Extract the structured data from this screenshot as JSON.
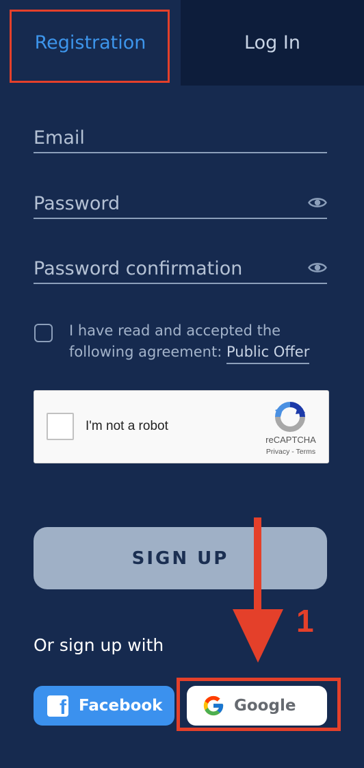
{
  "tabs": {
    "registration": "Registration",
    "login": "Log In"
  },
  "form": {
    "email_placeholder": "Email",
    "password_placeholder": "Password",
    "password_confirmation_placeholder": "Password confirmation",
    "agreement_text": "I have read and accepted the following agreement:",
    "public_offer_link": "Public Offer"
  },
  "recaptcha": {
    "label": "I'm not a robot",
    "brand": "reCAPTCHA",
    "privacy": "Privacy",
    "separator": "-",
    "terms": "Terms"
  },
  "signup_button": "SIGN UP",
  "social": {
    "heading": "Or sign up with",
    "facebook": "Facebook",
    "google": "Google"
  },
  "annotation": {
    "step_number": "1"
  },
  "colors": {
    "background": "#162a4f",
    "accent_blue": "#3d95eb",
    "annotation_red": "#e4402a",
    "facebook_blue": "#3b91ee"
  }
}
